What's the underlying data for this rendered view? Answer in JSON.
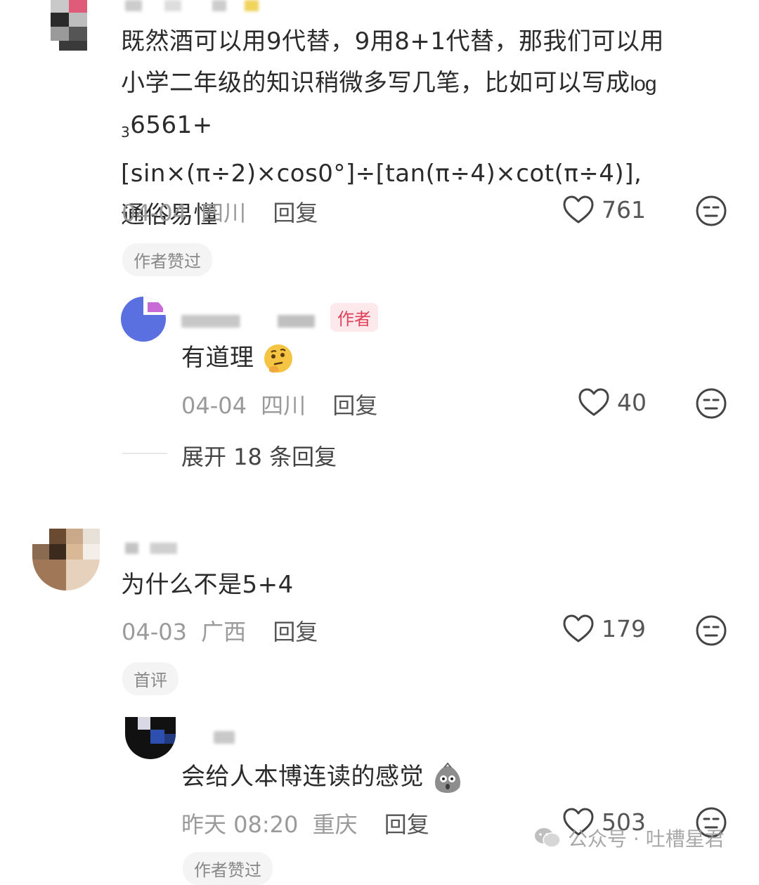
{
  "comments": [
    {
      "text_line1": "既然酒可以用9代替，9用8+1代替，那我们可以用",
      "text_line2_pre": "小学二年级的知识稍微多写几笔，比如可以写成",
      "text_line2_log": "log",
      "text_line3_sub": "3",
      "text_line3": "6561+[sin×(π÷2)×cos0°]÷[tan(π÷4)×cot(π÷4)],",
      "text_line4": "通俗易懂",
      "date": "04-04",
      "location": "四川",
      "reply_label": "回复",
      "likes": "761",
      "tag": "作者赞过"
    },
    {
      "author_badge": "作者",
      "text": "有道理",
      "emoji": "thinking-face",
      "date": "04-04",
      "location": "四川",
      "reply_label": "回复",
      "likes": "40",
      "expand_label": "展开 18 条回复"
    },
    {
      "text": "为什么不是5+4",
      "date": "04-03",
      "location": "广西",
      "reply_label": "回复",
      "likes": "179",
      "tag": "首评"
    },
    {
      "text": "会给人本博连读的感觉",
      "emoji": "shocked-sack",
      "date": "昨天 08:20",
      "location": "重庆",
      "reply_label": "回复",
      "likes": "503",
      "tag": "作者赞过"
    }
  ],
  "watermark": {
    "text": "公众号 · 吐槽星君",
    "icon": "wechat-icon"
  },
  "colors": {
    "author_badge": "#e0405a",
    "meta_gray": "#9a9a9a",
    "text": "#2b2b2b"
  }
}
